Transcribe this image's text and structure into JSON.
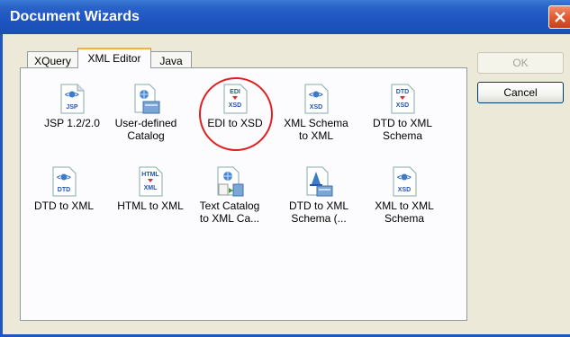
{
  "window": {
    "title": "Document Wizards"
  },
  "tabs": [
    {
      "label": "XQuery"
    },
    {
      "label": "XML Editor"
    },
    {
      "label": "Java"
    }
  ],
  "items": [
    {
      "label_line1": "JSP 1.2/2.0",
      "label_line2": "",
      "icon": "jsp-doc-icon",
      "badge": "JSP"
    },
    {
      "label_line1": "User-defined",
      "label_line2": "Catalog",
      "icon": "catalog-folder-icon"
    },
    {
      "label_line1": "EDI to XSD",
      "label_line2": "",
      "icon": "edi-to-xsd-icon",
      "top": "EDI",
      "bottom": "XSD"
    },
    {
      "label_line1": "XML Schema",
      "label_line2": "to XML",
      "icon": "xsd-doc-icon",
      "badge": "XSD"
    },
    {
      "label_line1": "DTD to XML",
      "label_line2": "Schema",
      "icon": "dtd-to-xsd-icon",
      "top": "DTD",
      "bottom": "XSD"
    },
    {
      "label_line1": "DTD to XML",
      "label_line2": "",
      "icon": "dtd-doc-icon",
      "badge": "DTD"
    },
    {
      "label_line1": "HTML to XML",
      "label_line2": "",
      "icon": "html-to-xml-icon",
      "top": "HTML",
      "bottom": "XML"
    },
    {
      "label_line1": "Text Catalog",
      "label_line2": "to XML Ca...",
      "icon": "text-catalog-icon"
    },
    {
      "label_line1": "DTD to XML",
      "label_line2": "Schema (...",
      "icon": "schema-folder-icon"
    },
    {
      "label_line1": "XML to XML",
      "label_line2": "Schema",
      "icon": "xml-to-xsd-icon",
      "badge": "XSD"
    }
  ],
  "buttons": {
    "ok": "OK",
    "cancel": "Cancel"
  },
  "colors": {
    "titlebar": "#1f56c2",
    "highlight": "#e02020",
    "tab_accent": "#f7b038"
  }
}
